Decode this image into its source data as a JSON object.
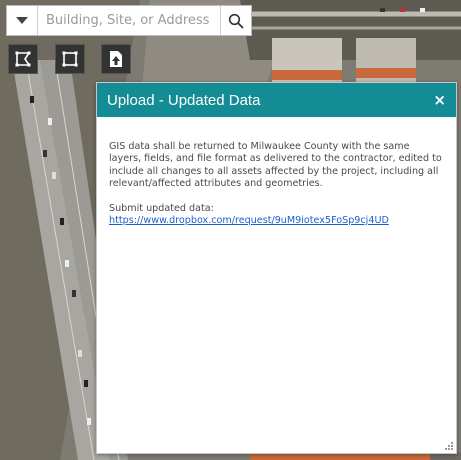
{
  "search": {
    "placeholder": "Building, Site, or Address",
    "dropdown_icon": "caret-down-icon",
    "search_icon": "magnifier-icon"
  },
  "tools": [
    {
      "icon": "polygon-select-icon"
    },
    {
      "icon": "rectangle-select-icon"
    },
    {
      "icon": "file-upload-icon"
    }
  ],
  "panel": {
    "title": "Upload - Updated Data",
    "close_label": "×",
    "body_text": "GIS data shall be returned to Milwaukee County with the same layers, fields, and file format as delivered to the contractor, edited to include all changes to all assets affected by the project, including all relevant/affected attributes and geometries.",
    "submit_label": "Submit updated data:",
    "link_text": "https://www.dropbox.com/request/9uM9iotex5FoSp9cj4UD",
    "header_color": "#148c96"
  }
}
